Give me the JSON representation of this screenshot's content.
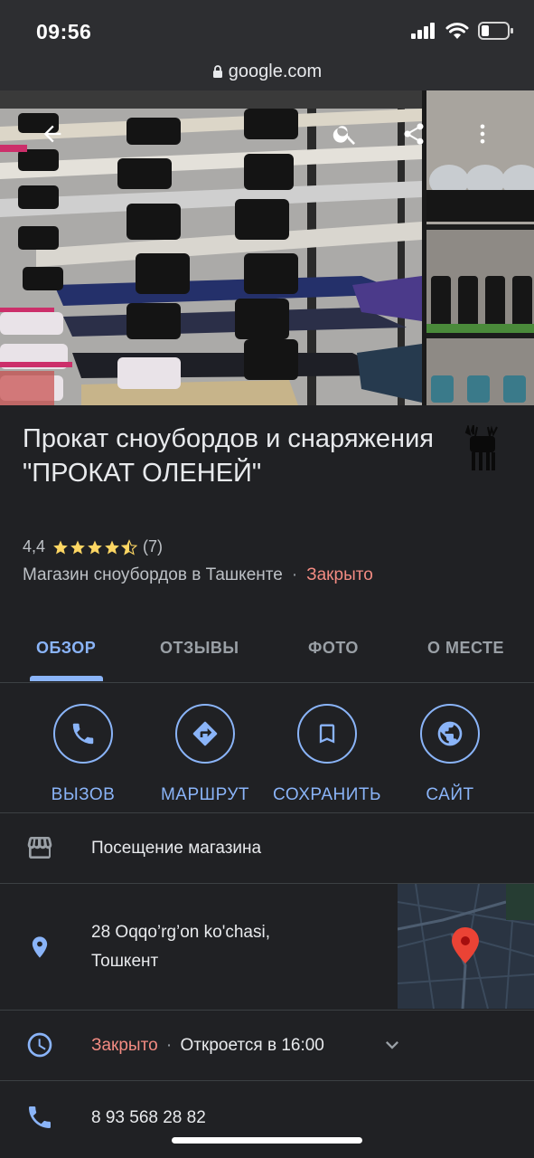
{
  "status_bar": {
    "time": "09:56"
  },
  "browser": {
    "url": "google.com"
  },
  "place": {
    "title": "Прокат сноубордов и снаряжения \"ПРОКАТ ОЛЕНЕЙ\"",
    "rating": "4,4",
    "stars": 4.4,
    "reviews_count": "(7)",
    "category": "Магазин сноубордов в Ташкенте",
    "separator": "·",
    "open_status": "Закрыто"
  },
  "tabs": [
    {
      "label": "ОБЗОР",
      "active": true
    },
    {
      "label": "ОТЗЫВЫ",
      "active": false
    },
    {
      "label": "ФОТО",
      "active": false
    },
    {
      "label": "О МЕСТЕ",
      "active": false
    }
  ],
  "actions": [
    {
      "label": "ВЫЗОВ",
      "icon": "phone-icon"
    },
    {
      "label": "МАРШРУТ",
      "icon": "directions-icon"
    },
    {
      "label": "СОХРАНИТЬ",
      "icon": "bookmark-icon"
    },
    {
      "label": "САЙТ",
      "icon": "globe-icon"
    }
  ],
  "details": {
    "visit": "Посещение магазина",
    "address_line1": "28 Oqqo’rg’on ko'chasi,",
    "address_line2": "Тошкент",
    "hours_status": "Закрыто",
    "hours_separator": "·",
    "hours_next": "Откроется в 16:00",
    "phone": "8 93 568 28 82"
  },
  "colors": {
    "background": "#202124",
    "accent": "#8ab4f8",
    "closed": "#f28b82",
    "star": "#fdd663",
    "text": "#e8eaed",
    "secondary_text": "#bdc1c6"
  }
}
